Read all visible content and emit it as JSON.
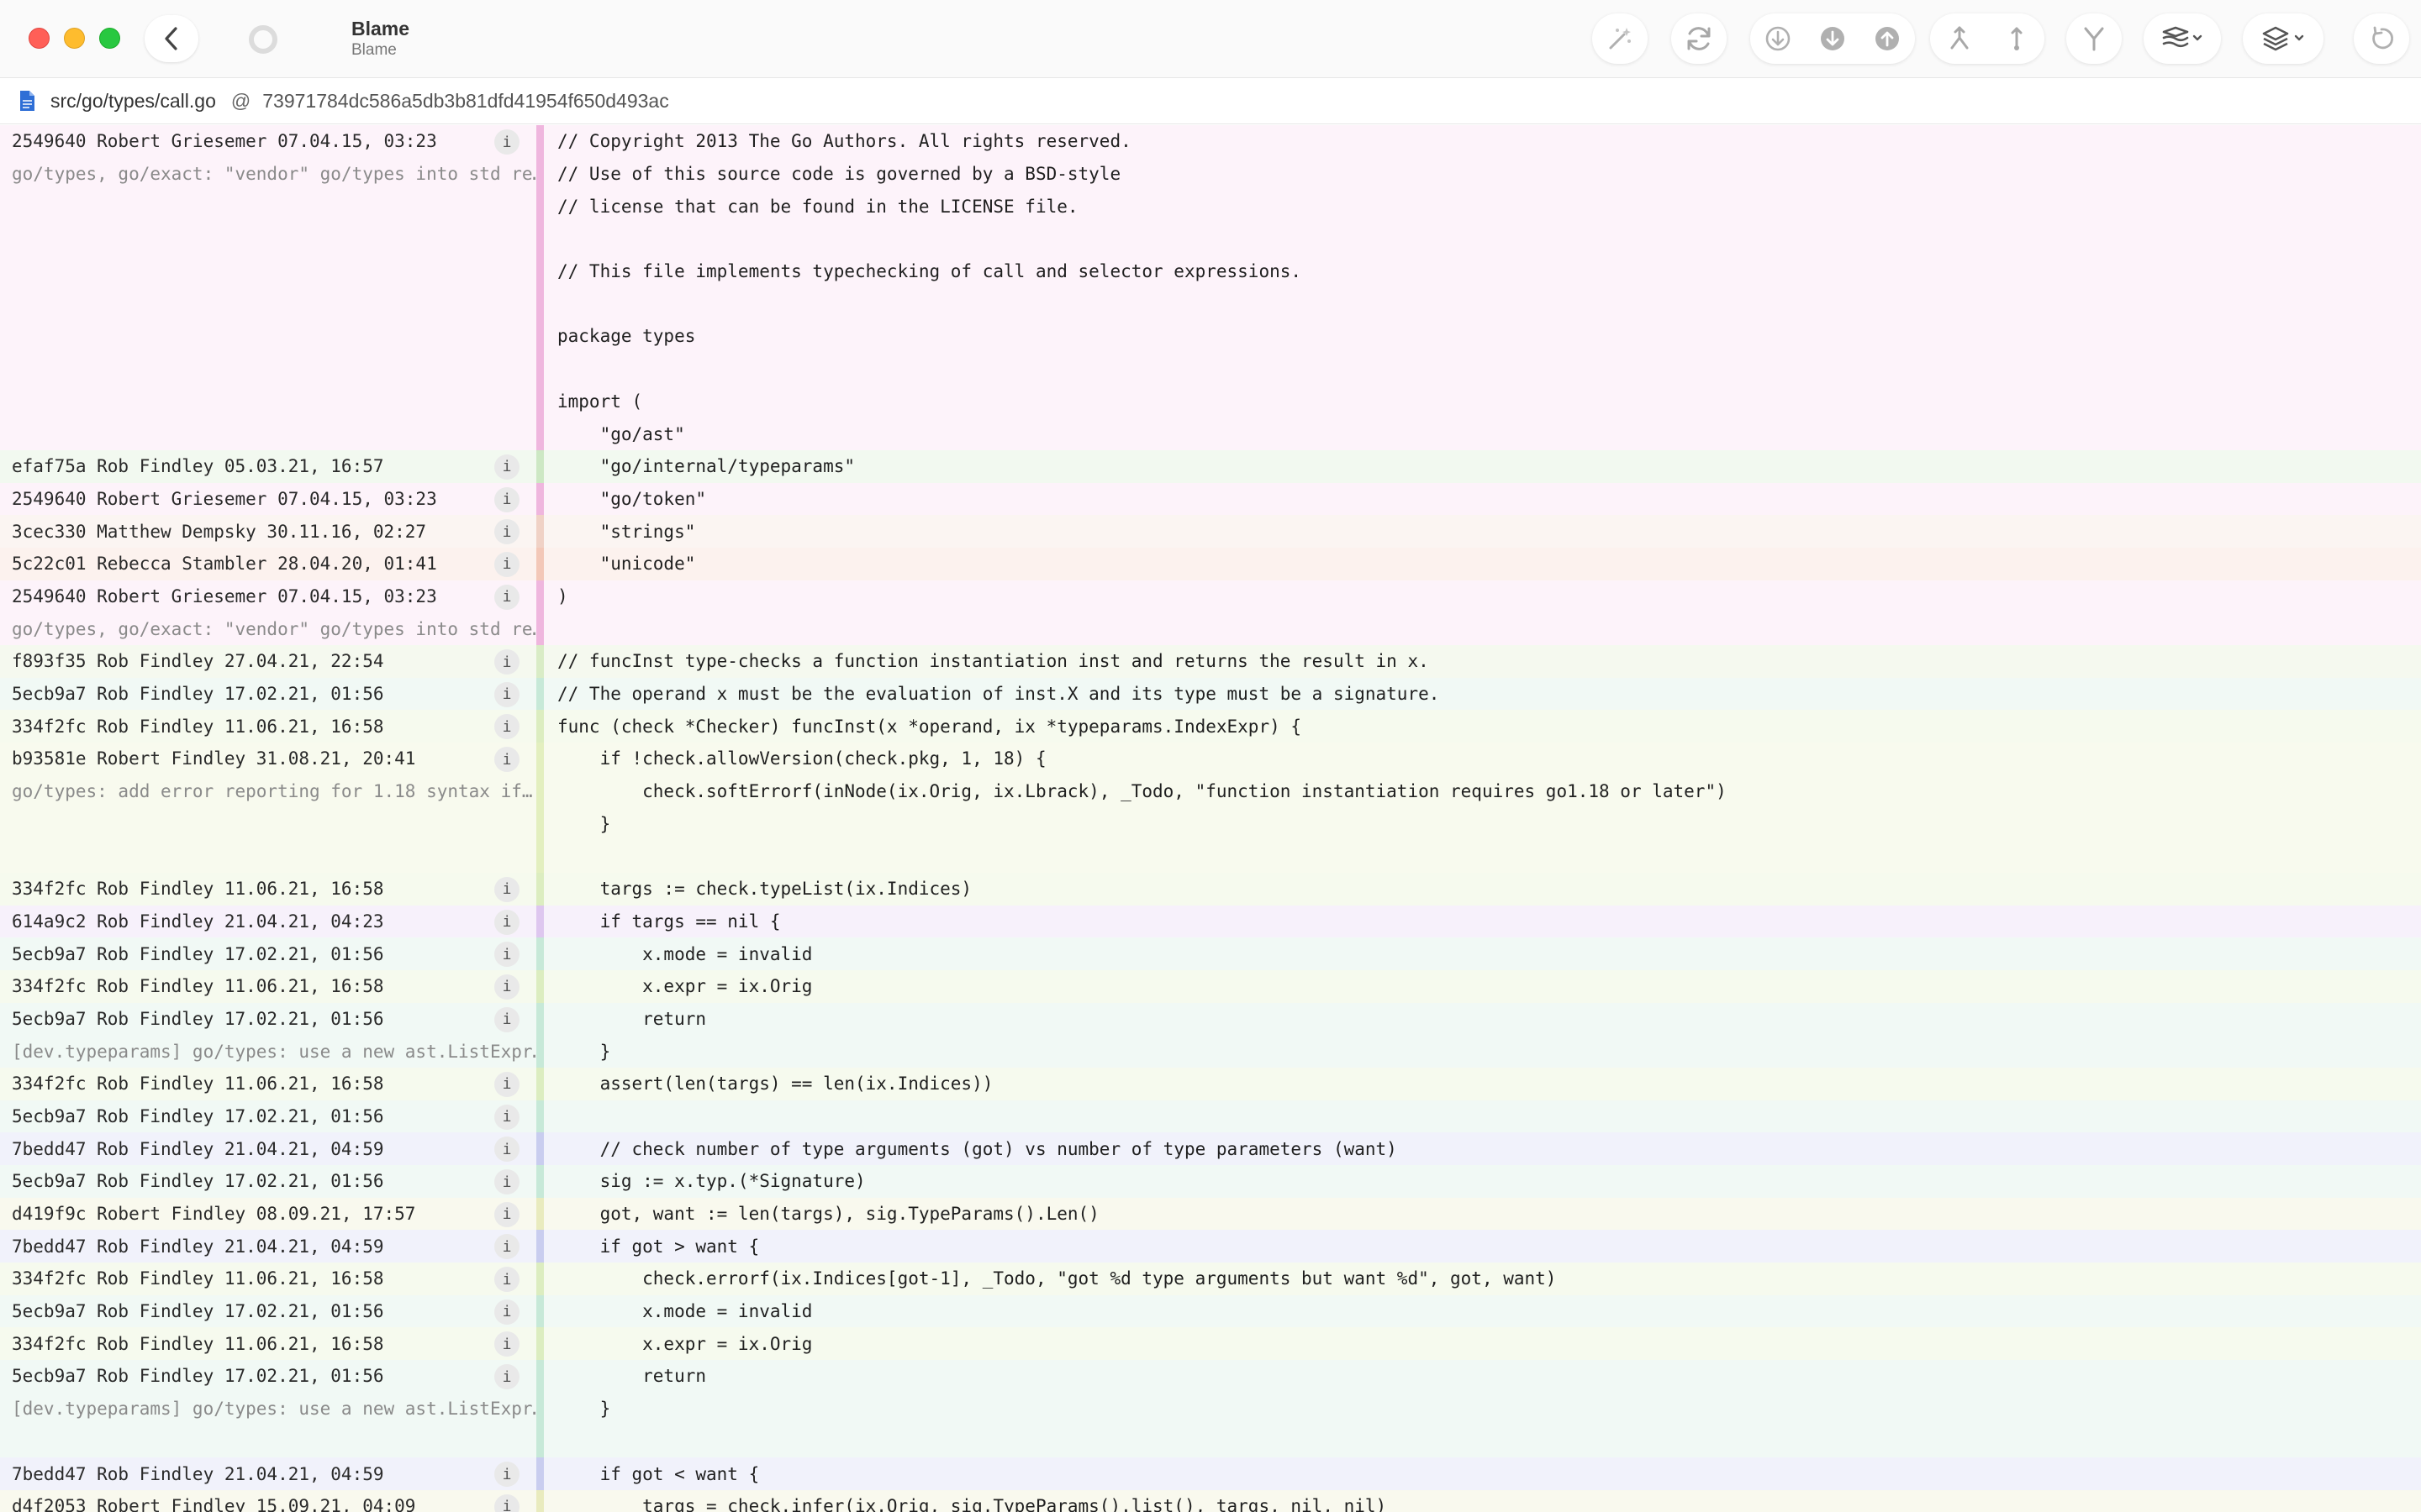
{
  "window": {
    "title": "Blame",
    "subtitle": "Blame"
  },
  "toolbar": {
    "icons": [
      "magic-wand-icon",
      "refresh-icon",
      "fetch-icon",
      "pull-icon",
      "push-icon",
      "merge-icon",
      "branch-vertical-icon",
      "fork-icon",
      "stash-icon",
      "layers-icon",
      "undo-icon"
    ]
  },
  "pathbar": {
    "path": "src/go/types/call.go",
    "at": "@",
    "commit": "73971784dc586a5db3b81dfd41954f650d493ac"
  },
  "colors": {
    "pink": "#fbf1f8",
    "green": "#f2f8ef",
    "lilac": "#f6f1fa",
    "blue": "#eef0f9"
  },
  "lines": [
    {
      "blame": "2549640 Robert Griesemer 07.04.15, 03:23",
      "info": "i",
      "code": "// Copyright 2013 The Go Authors. All rights reserved.",
      "bg": "#fdf3fa",
      "strip": "#efb6de"
    },
    {
      "blame": "go/types, go/exact: \"vendor\" go/types into std re…",
      "msg": true,
      "code": "// Use of this source code is governed by a BSD-style",
      "bg": "#fdf3fa",
      "strip": "#efb6de"
    },
    {
      "blame": "",
      "code": "// license that can be found in the LICENSE file.",
      "bg": "#fdf3fa",
      "strip": "#efb6de"
    },
    {
      "blame": "",
      "code": "",
      "bg": "#fdf3fa",
      "strip": "#efb6de"
    },
    {
      "blame": "",
      "code": "// This file implements typechecking of call and selector expressions.",
      "bg": "#fdf3fa",
      "strip": "#efb6de"
    },
    {
      "blame": "",
      "code": "",
      "bg": "#fdf3fa",
      "strip": "#efb6de"
    },
    {
      "blame": "",
      "code": "package types",
      "bg": "#fdf3fa",
      "strip": "#efb6de"
    },
    {
      "blame": "",
      "code": "",
      "bg": "#fdf3fa",
      "strip": "#efb6de"
    },
    {
      "blame": "",
      "code": "import (",
      "bg": "#fdf3fa",
      "strip": "#efb6de"
    },
    {
      "blame": "",
      "code": "    \"go/ast\"",
      "bg": "#fdf3fa",
      "strip": "#efb6de"
    },
    {
      "blame": "efaf75a Rob Findley 05.03.21, 16:57",
      "info": "i",
      "code": "    \"go/internal/typeparams\"",
      "bg": "#f2f9f0",
      "strip": "#cde8c4"
    },
    {
      "blame": "2549640 Robert Griesemer 07.04.15, 03:23",
      "info": "i",
      "code": "    \"go/token\"",
      "bg": "#fdf3fa",
      "strip": "#efb6de"
    },
    {
      "blame": "3cec330 Matthew Dempsky 30.11.16, 02:27",
      "info": "i",
      "code": "    \"strings\"",
      "bg": "#fbf5f2",
      "strip": "#f0d2c6"
    },
    {
      "blame": "5c22c01 Rebecca Stambler 28.04.20, 01:41",
      "info": "i",
      "code": "    \"unicode\"",
      "bg": "#fcf2ee",
      "strip": "#f3c8b8"
    },
    {
      "blame": "2549640 Robert Griesemer 07.04.15, 03:23",
      "info": "i",
      "code": ")",
      "bg": "#fdf3fa",
      "strip": "#efb6de"
    },
    {
      "blame": "go/types, go/exact: \"vendor\" go/types into std re…",
      "msg": true,
      "code": "",
      "bg": "#fdf3fa",
      "strip": "#efb6de"
    },
    {
      "blame": "f893f35 Rob Findley 27.04.21, 22:54",
      "info": "i",
      "code": "// funcInst type-checks a function instantiation inst and returns the result in x.",
      "bg": "#f5f9ef",
      "strip": "#d9ecc6"
    },
    {
      "blame": "5ecb9a7 Rob Findley 17.02.21, 01:56",
      "info": "i",
      "code": "// The operand x must be the evaluation of inst.X and its type must be a signature.",
      "bg": "#f1f9f5",
      "strip": "#c7e9d8"
    },
    {
      "blame": "334f2fc Rob Findley 11.06.21, 16:58",
      "info": "i",
      "code": "func (check *Checker) funcInst(x *operand, ix *typeparams.IndexExpr) {",
      "bg": "#f6faee",
      "strip": "#dcedc0"
    },
    {
      "blame": "b93581e Robert Findley 31.08.21, 20:41",
      "info": "i",
      "code": "    if !check.allowVersion(check.pkg, 1, 18) {",
      "bg": "#f8faee",
      "strip": "#e3efbf"
    },
    {
      "blame": "go/types: add error reporting for 1.18 syntax if…",
      "msg": true,
      "code": "        check.softErrorf(inNode(ix.Orig, ix.Lbrack), _Todo, \"function instantiation requires go1.18 or later\")",
      "bg": "#f8faee",
      "strip": "#e3efbf"
    },
    {
      "blame": "",
      "code": "    }",
      "bg": "#f8faee",
      "strip": "#e3efbf"
    },
    {
      "blame": "",
      "code": "",
      "bg": "#f8faee",
      "strip": "#e3efbf"
    },
    {
      "blame": "334f2fc Rob Findley 11.06.21, 16:58",
      "info": "i",
      "code": "    targs := check.typeList(ix.Indices)",
      "bg": "#f6faee",
      "strip": "#dcedc0"
    },
    {
      "blame": "614a9c2 Rob Findley 21.04.21, 04:23",
      "info": "i",
      "code": "    if targs == nil {",
      "bg": "#f7f1fb",
      "strip": "#dec7ef"
    },
    {
      "blame": "5ecb9a7 Rob Findley 17.02.21, 01:56",
      "info": "i",
      "code": "        x.mode = invalid",
      "bg": "#f1f9f5",
      "strip": "#c7e9d8"
    },
    {
      "blame": "334f2fc Rob Findley 11.06.21, 16:58",
      "info": "i",
      "code": "        x.expr = ix.Orig",
      "bg": "#f6faee",
      "strip": "#dcedc0"
    },
    {
      "blame": "5ecb9a7 Rob Findley 17.02.21, 01:56",
      "info": "i",
      "code": "        return",
      "bg": "#f1f9f5",
      "strip": "#c7e9d8"
    },
    {
      "blame": "[dev.typeparams] go/types: use a new ast.ListExpr…",
      "msg": true,
      "code": "    }",
      "bg": "#f1f9f5",
      "strip": "#c7e9d8"
    },
    {
      "blame": "334f2fc Rob Findley 11.06.21, 16:58",
      "info": "i",
      "code": "    assert(len(targs) == len(ix.Indices))",
      "bg": "#f6faee",
      "strip": "#dcedc0"
    },
    {
      "blame": "5ecb9a7 Rob Findley 17.02.21, 01:56",
      "info": "i",
      "code": "",
      "bg": "#f1f9f5",
      "strip": "#c7e9d8"
    },
    {
      "blame": "7bedd47 Rob Findley 21.04.21, 04:59",
      "info": "i",
      "code": "    // check number of type arguments (got) vs number of type parameters (want)",
      "bg": "#f1f2fb",
      "strip": "#c9cdef"
    },
    {
      "blame": "5ecb9a7 Rob Findley 17.02.21, 01:56",
      "info": "i",
      "code": "    sig := x.typ.(*Signature)",
      "bg": "#f1f9f5",
      "strip": "#c7e9d8"
    },
    {
      "blame": "d419f9c Robert Findley 08.09.21, 17:57",
      "info": "i",
      "code": "    got, want := len(targs), sig.TypeParams().Len()",
      "bg": "#f9f9ee",
      "strip": "#e9ebbe"
    },
    {
      "blame": "7bedd47 Rob Findley 21.04.21, 04:59",
      "info": "i",
      "code": "    if got > want {",
      "bg": "#f1f2fb",
      "strip": "#c9cdef"
    },
    {
      "blame": "334f2fc Rob Findley 11.06.21, 16:58",
      "info": "i",
      "code": "        check.errorf(ix.Indices[got-1], _Todo, \"got %d type arguments but want %d\", got, want)",
      "bg": "#f6faee",
      "strip": "#dcedc0"
    },
    {
      "blame": "5ecb9a7 Rob Findley 17.02.21, 01:56",
      "info": "i",
      "code": "        x.mode = invalid",
      "bg": "#f1f9f5",
      "strip": "#c7e9d8"
    },
    {
      "blame": "334f2fc Rob Findley 11.06.21, 16:58",
      "info": "i",
      "code": "        x.expr = ix.Orig",
      "bg": "#f6faee",
      "strip": "#dcedc0"
    },
    {
      "blame": "5ecb9a7 Rob Findley 17.02.21, 01:56",
      "info": "i",
      "code": "        return",
      "bg": "#f1f9f5",
      "strip": "#c7e9d8"
    },
    {
      "blame": "[dev.typeparams] go/types: use a new ast.ListExpr…",
      "msg": true,
      "code": "    }",
      "bg": "#f1f9f5",
      "strip": "#c7e9d8"
    },
    {
      "blame": "",
      "code": "",
      "bg": "#f1f9f5",
      "strip": "#c7e9d8"
    },
    {
      "blame": "7bedd47 Rob Findley 21.04.21, 04:59",
      "info": "i",
      "code": "    if got < want {",
      "bg": "#f1f2fb",
      "strip": "#c9cdef"
    },
    {
      "blame": "d4f2053 Robert Findley 15.09.21, 04:09",
      "info": "i",
      "code": "        targs = check.infer(ix.Orig, sig.TypeParams().list(), targs, nil, nil)",
      "bg": "#f9f9ee",
      "strip": "#e9ebbe"
    }
  ]
}
